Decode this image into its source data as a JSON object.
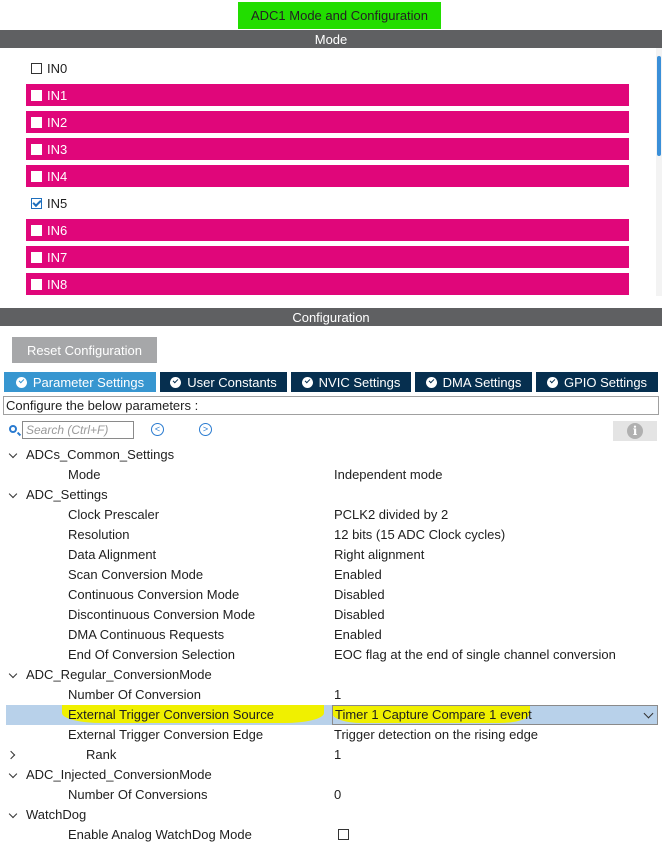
{
  "window": {
    "title": "ADC1 Mode and Configuration"
  },
  "mode_section": {
    "header": "Mode",
    "channels": [
      {
        "label": "IN0",
        "checked": false,
        "error": false
      },
      {
        "label": "IN1",
        "checked": false,
        "error": true
      },
      {
        "label": "IN2",
        "checked": false,
        "error": true
      },
      {
        "label": "IN3",
        "checked": false,
        "error": true
      },
      {
        "label": "IN4",
        "checked": false,
        "error": true
      },
      {
        "label": "IN5",
        "checked": true,
        "error": false
      },
      {
        "label": "IN6",
        "checked": false,
        "error": true
      },
      {
        "label": "IN7",
        "checked": false,
        "error": true
      },
      {
        "label": "IN8",
        "checked": false,
        "error": true
      }
    ],
    "error_color": "#e0067a"
  },
  "config_section": {
    "header": "Configuration",
    "reset_label": "Reset Configuration",
    "tabs": [
      {
        "label": "Parameter Settings",
        "active": true
      },
      {
        "label": "User Constants",
        "active": false
      },
      {
        "label": "NVIC Settings",
        "active": false
      },
      {
        "label": "DMA Settings",
        "active": false
      },
      {
        "label": "GPIO Settings",
        "active": false
      }
    ],
    "configure_text": "Configure the below parameters :",
    "search_placeholder": "Search (Ctrl+F)"
  },
  "tree": [
    {
      "type": "group",
      "label": "ADCs_Common_Settings",
      "expanded": true
    },
    {
      "type": "param",
      "label": "Mode",
      "value": "Independent mode"
    },
    {
      "type": "group",
      "label": "ADC_Settings",
      "expanded": true
    },
    {
      "type": "param",
      "label": "Clock Prescaler",
      "value": "PCLK2 divided by 2"
    },
    {
      "type": "param",
      "label": "Resolution",
      "value": "12 bits (15 ADC Clock cycles)"
    },
    {
      "type": "param",
      "label": "Data Alignment",
      "value": "Right alignment"
    },
    {
      "type": "param",
      "label": "Scan Conversion Mode",
      "value": "Enabled"
    },
    {
      "type": "param",
      "label": "Continuous Conversion Mode",
      "value": "Disabled"
    },
    {
      "type": "param",
      "label": "Discontinuous Conversion Mode",
      "value": "Disabled"
    },
    {
      "type": "param",
      "label": "DMA Continuous Requests",
      "value": "Enabled"
    },
    {
      "type": "param",
      "label": "End Of Conversion Selection",
      "value": "EOC flag at the end of single channel conversion"
    },
    {
      "type": "group",
      "label": "ADC_Regular_ConversionMode",
      "expanded": true
    },
    {
      "type": "param",
      "label": "Number Of Conversion",
      "value": "1"
    },
    {
      "type": "param",
      "label": "External Trigger Conversion Source",
      "value": "Timer 1 Capture Compare 1 event",
      "selected": true,
      "dropdown": true
    },
    {
      "type": "param",
      "label": "External Trigger Conversion Edge",
      "value": "Trigger detection on the rising edge"
    },
    {
      "type": "subgroup",
      "label": "Rank",
      "value": "1",
      "expanded": false
    },
    {
      "type": "group",
      "label": "ADC_Injected_ConversionMode",
      "expanded": true
    },
    {
      "type": "param",
      "label": "Number Of Conversions",
      "value": "0"
    },
    {
      "type": "group",
      "label": "WatchDog",
      "expanded": true
    },
    {
      "type": "param",
      "label": "Enable Analog WatchDog Mode",
      "value": "",
      "checkbox": true,
      "checked": false
    }
  ]
}
